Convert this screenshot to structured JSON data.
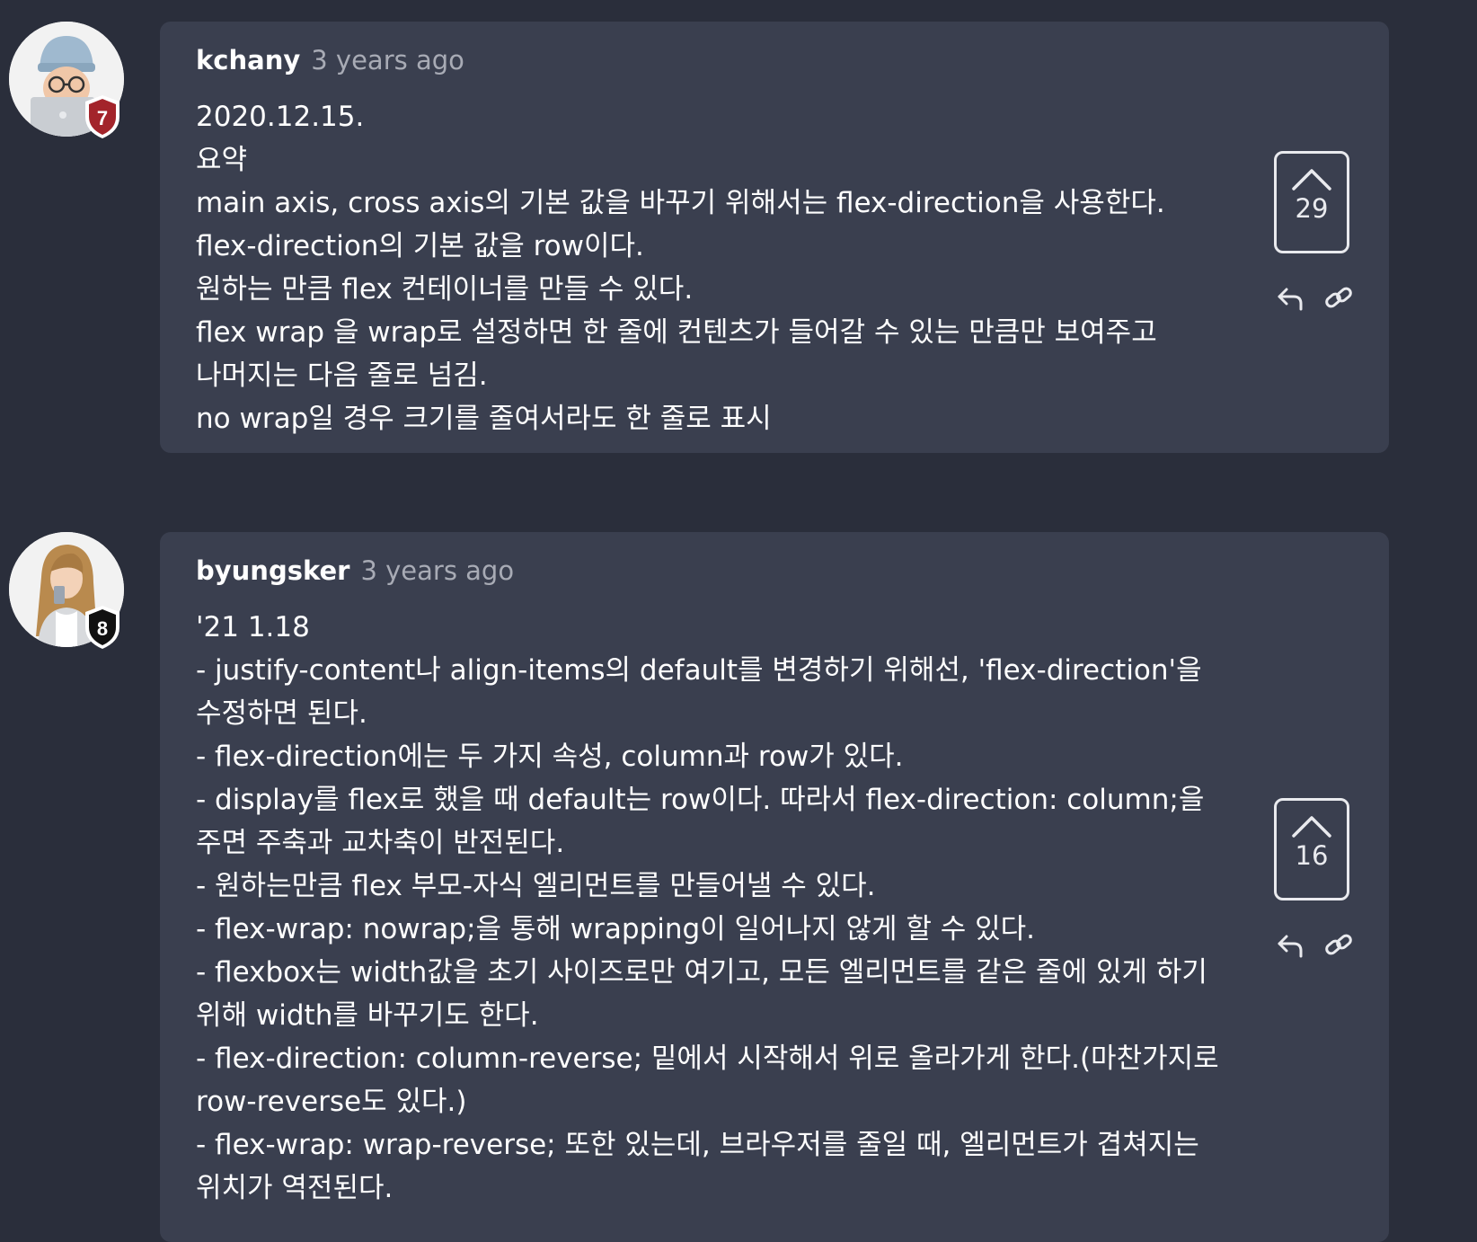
{
  "comments": [
    {
      "author": "kchany",
      "time": "3 years ago",
      "badge": "7",
      "badge_color": "#a3242b",
      "lines": [
        "2020.12.15.",
        "요약",
        "main axis, cross axis의 기본 값을 바꾸기 위해서는 flex-direction을 사용한다.",
        "flex-direction의 기본 값을 row이다.",
        "원하는 만큼 flex 컨테이너를 만들 수 있다.",
        "flex wrap 을 wrap로 설정하면 한 줄에 컨텐츠가 들어갈 수 있는 만큼만 보여주고",
        "나머지는 다음 줄로 넘김.",
        "no wrap일 경우 크기를 줄여서라도 한 줄로 표시"
      ],
      "votes": "29",
      "upvote_icon": "chevron-up-icon",
      "reply_icon": "reply-arrow-icon",
      "link_icon": "chain-link-icon"
    },
    {
      "author": "byungsker",
      "time": "3 years ago",
      "badge": "8",
      "badge_color": "#111111",
      "lines": [
        "'21 1.18",
        "- justify-content나 align-items의 default를 변경하기 위해선, 'flex-direction'을",
        "수정하면 된다.",
        "- flex-direction에는 두 가지 속성, column과 row가 있다.",
        "- display를 flex로 했을 때 default는 row이다. 따라서 flex-direction: column;을",
        "주면 주축과 교차축이 반전된다.",
        "- 원하는만큼 flex 부모-자식 엘리먼트를 만들어낼 수 있다.",
        "- flex-wrap: nowrap;을 통해 wrapping이 일어나지 않게 할 수 있다.",
        "- flexbox는 width값을 초기 사이즈로만 여기고, 모든 엘리먼트를 같은 줄에 있게 하기",
        "위해 width를 바꾸기도 한다.",
        "- flex-direction: column-reverse; 밑에서 시작해서 위로 올라가게 한다.(마찬가지로",
        "row-reverse도 있다.)",
        "- flex-wrap: wrap-reverse; 또한 있는데, 브라우저를 줄일 때, 엘리먼트가 겹쳐지는",
        "위치가 역전된다."
      ],
      "votes": "16",
      "upvote_icon": "chevron-up-icon",
      "reply_icon": "reply-arrow-icon",
      "link_icon": "chain-link-icon"
    }
  ]
}
